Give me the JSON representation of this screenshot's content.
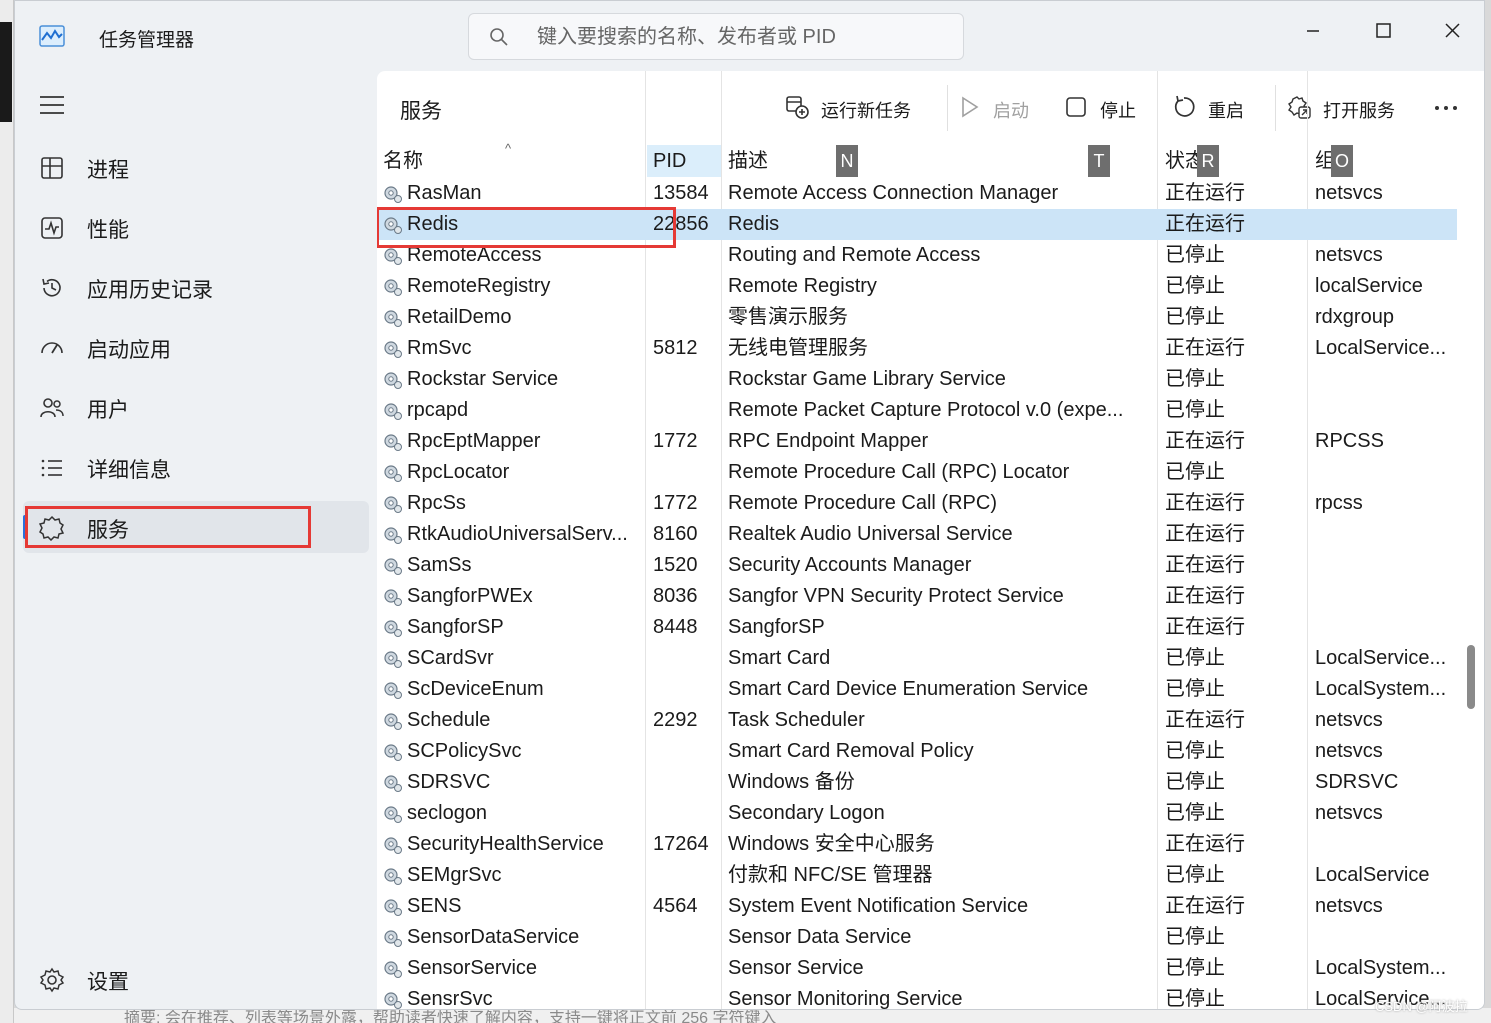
{
  "window": {
    "title": "任务管理器",
    "search_placeholder": "键入要搜索的名称、发布者或 PID"
  },
  "sidebar": {
    "items": [
      {
        "label": "进程",
        "icon": "processes-icon"
      },
      {
        "label": "性能",
        "icon": "performance-icon"
      },
      {
        "label": "应用历史记录",
        "icon": "history-icon"
      },
      {
        "label": "启动应用",
        "icon": "startup-icon"
      },
      {
        "label": "用户",
        "icon": "users-icon"
      },
      {
        "label": "详细信息",
        "icon": "details-icon"
      },
      {
        "label": "服务",
        "icon": "services-icon",
        "active": true
      }
    ],
    "settings_label": "设置"
  },
  "toolbar": {
    "page_title": "服务",
    "run_new_task": "运行新任务",
    "start": "启动",
    "stop": "停止",
    "restart": "重启",
    "open_services": "打开服务"
  },
  "table": {
    "headers": {
      "name": "名称",
      "pid": "PID",
      "desc": "描述",
      "status": "状态",
      "group": "组"
    },
    "badges": [
      "N",
      "T",
      "R",
      "O"
    ],
    "selected_row": 1,
    "rows": [
      {
        "name": "RasMan",
        "pid": "13584",
        "desc": "Remote Access Connection Manager",
        "status": "正在运行",
        "group": "netsvcs"
      },
      {
        "name": "Redis",
        "pid": "22856",
        "desc": "Redis",
        "status": "正在运行",
        "group": ""
      },
      {
        "name": "RemoteAccess",
        "pid": "",
        "desc": "Routing and Remote Access",
        "status": "已停止",
        "group": "netsvcs"
      },
      {
        "name": "RemoteRegistry",
        "pid": "",
        "desc": "Remote Registry",
        "status": "已停止",
        "group": "localService"
      },
      {
        "name": "RetailDemo",
        "pid": "",
        "desc": "零售演示服务",
        "status": "已停止",
        "group": "rdxgroup"
      },
      {
        "name": "RmSvc",
        "pid": "5812",
        "desc": "无线电管理服务",
        "status": "正在运行",
        "group": "LocalService..."
      },
      {
        "name": "Rockstar Service",
        "pid": "",
        "desc": "Rockstar Game Library Service",
        "status": "已停止",
        "group": ""
      },
      {
        "name": "rpcapd",
        "pid": "",
        "desc": "Remote Packet Capture Protocol v.0 (expe...",
        "status": "已停止",
        "group": ""
      },
      {
        "name": "RpcEptMapper",
        "pid": "1772",
        "desc": "RPC Endpoint Mapper",
        "status": "正在运行",
        "group": "RPCSS"
      },
      {
        "name": "RpcLocator",
        "pid": "",
        "desc": "Remote Procedure Call (RPC) Locator",
        "status": "已停止",
        "group": ""
      },
      {
        "name": "RpcSs",
        "pid": "1772",
        "desc": "Remote Procedure Call (RPC)",
        "status": "正在运行",
        "group": "rpcss"
      },
      {
        "name": "RtkAudioUniversalServ...",
        "pid": "8160",
        "desc": "Realtek Audio Universal Service",
        "status": "正在运行",
        "group": ""
      },
      {
        "name": "SamSs",
        "pid": "1520",
        "desc": "Security Accounts Manager",
        "status": "正在运行",
        "group": ""
      },
      {
        "name": "SangforPWEx",
        "pid": "8036",
        "desc": "Sangfor VPN Security Protect Service",
        "status": "正在运行",
        "group": ""
      },
      {
        "name": "SangforSP",
        "pid": "8448",
        "desc": "SangforSP",
        "status": "正在运行",
        "group": ""
      },
      {
        "name": "SCardSvr",
        "pid": "",
        "desc": "Smart Card",
        "status": "已停止",
        "group": "LocalService..."
      },
      {
        "name": "ScDeviceEnum",
        "pid": "",
        "desc": "Smart Card Device Enumeration Service",
        "status": "已停止",
        "group": "LocalSystem..."
      },
      {
        "name": "Schedule",
        "pid": "2292",
        "desc": "Task Scheduler",
        "status": "正在运行",
        "group": "netsvcs"
      },
      {
        "name": "SCPolicySvc",
        "pid": "",
        "desc": "Smart Card Removal Policy",
        "status": "已停止",
        "group": "netsvcs"
      },
      {
        "name": "SDRSVC",
        "pid": "",
        "desc": "Windows 备份",
        "status": "已停止",
        "group": "SDRSVC"
      },
      {
        "name": "seclogon",
        "pid": "",
        "desc": "Secondary Logon",
        "status": "已停止",
        "group": "netsvcs"
      },
      {
        "name": "SecurityHealthService",
        "pid": "17264",
        "desc": "Windows 安全中心服务",
        "status": "正在运行",
        "group": ""
      },
      {
        "name": "SEMgrSvc",
        "pid": "",
        "desc": "付款和 NFC/SE 管理器",
        "status": "已停止",
        "group": "LocalService"
      },
      {
        "name": "SENS",
        "pid": "4564",
        "desc": "System Event Notification Service",
        "status": "正在运行",
        "group": "netsvcs"
      },
      {
        "name": "SensorDataService",
        "pid": "",
        "desc": "Sensor Data Service",
        "status": "已停止",
        "group": ""
      },
      {
        "name": "SensorService",
        "pid": "",
        "desc": "Sensor Service",
        "status": "已停止",
        "group": "LocalSystem..."
      },
      {
        "name": "SensrSvc",
        "pid": "",
        "desc": "Sensor Monitoring Service",
        "status": "已停止",
        "group": "LocalService..."
      }
    ]
  },
  "background": {
    "bottom_text": "摘要: 会在推荐、列表等场景外露，帮助读者快速了解内容，支持一键将正文前 256 字符键入",
    "watermark": "CSDN @阿波拉"
  },
  "colors": {
    "selected_row": "#cce4f7",
    "highlight_box": "#e53935",
    "accent": "#2a6fdb"
  }
}
